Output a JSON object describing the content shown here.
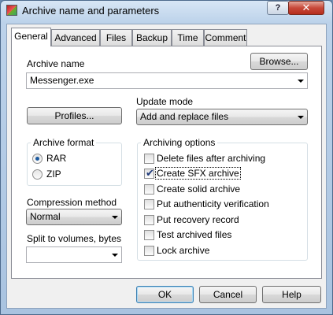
{
  "window": {
    "title": "Archive name and parameters",
    "help_label": "?",
    "close_label": "✕"
  },
  "tabs": [
    {
      "label": "General",
      "active": true
    },
    {
      "label": "Advanced"
    },
    {
      "label": "Files"
    },
    {
      "label": "Backup"
    },
    {
      "label": "Time"
    },
    {
      "label": "Comment"
    }
  ],
  "general": {
    "archive_name_label": "Archive name",
    "browse_label": "Browse...",
    "archive_name_value": "Messenger.exe",
    "profiles_label": "Profiles...",
    "update_mode_label": "Update mode",
    "update_mode_value": "Add and replace files",
    "archive_format": {
      "title": "Archive format",
      "options": [
        {
          "label": "RAR",
          "selected": true
        },
        {
          "label": "ZIP",
          "selected": false
        }
      ]
    },
    "compression_label": "Compression method",
    "compression_value": "Normal",
    "split_label": "Split to volumes, bytes",
    "split_value": "",
    "archiving_options": {
      "title": "Archiving options",
      "items": [
        {
          "label": "Delete files after archiving",
          "checked": false
        },
        {
          "label": "Create SFX archive",
          "checked": true
        },
        {
          "label": "Create solid archive",
          "checked": false
        },
        {
          "label": "Put authenticity verification",
          "checked": false
        },
        {
          "label": "Put recovery record",
          "checked": false
        },
        {
          "label": "Test archived files",
          "checked": false
        },
        {
          "label": "Lock archive",
          "checked": false
        }
      ]
    }
  },
  "footer": {
    "ok_label": "OK",
    "cancel_label": "Cancel",
    "help_label": "Help"
  }
}
